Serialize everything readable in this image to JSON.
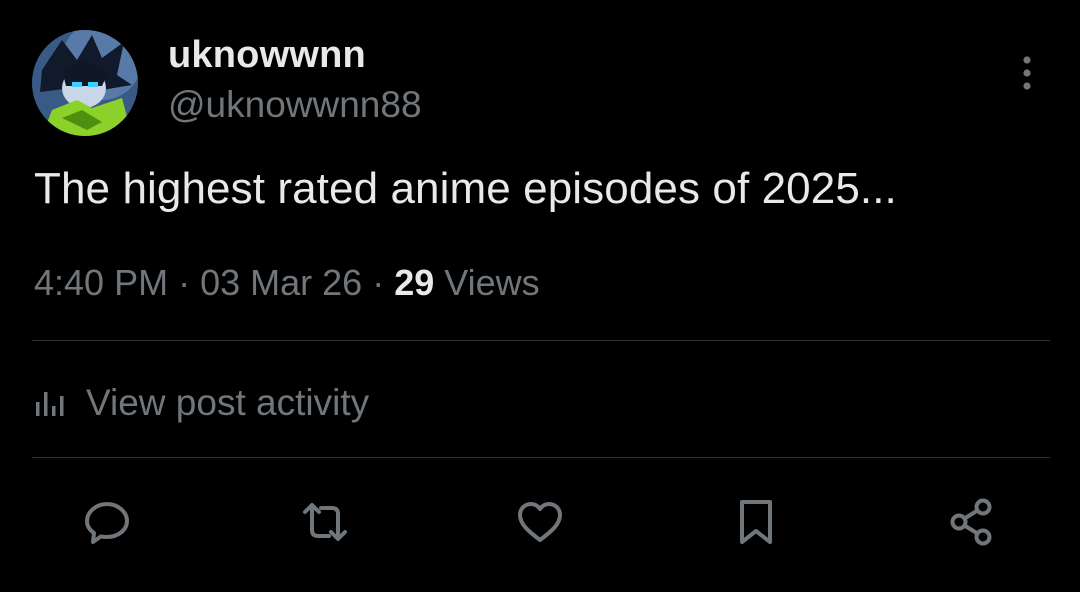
{
  "user": {
    "display_name": "uknowwnn",
    "handle": "@uknowwnn88"
  },
  "post": {
    "text": "The highest rated anime episodes of 2025...",
    "time": "4:40 PM",
    "date": "03 Mar 26",
    "views_count": "29",
    "views_label": "Views"
  },
  "activity": {
    "label": "View post activity",
    "icon": "bar-chart-icon"
  },
  "actions": {
    "reply_icon": "reply-icon",
    "repost_icon": "repost-icon",
    "like_icon": "heart-icon",
    "bookmark_icon": "bookmark-icon",
    "share_icon": "share-icon"
  },
  "colors": {
    "background": "#000000",
    "primary_text": "#e7e9ea",
    "secondary_text": "#71767b",
    "divider": "#2f3336"
  }
}
